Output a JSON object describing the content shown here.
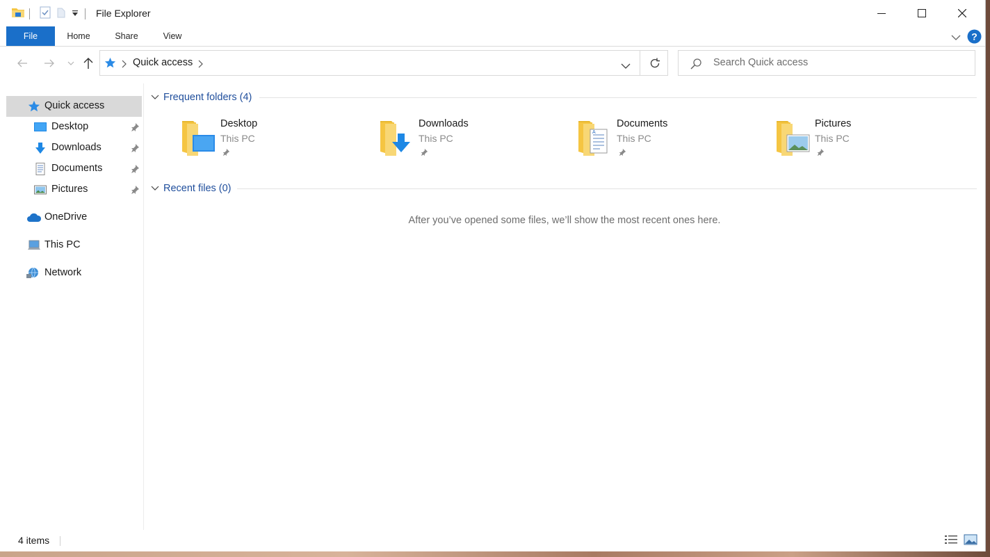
{
  "window": {
    "title": "File Explorer",
    "controls": {
      "minimize": "minimize-icon",
      "maximize": "maximize-icon",
      "close": "close-icon"
    }
  },
  "ribbon": {
    "tabs": [
      {
        "label": "File",
        "active": true
      },
      {
        "label": "Home"
      },
      {
        "label": "Share"
      },
      {
        "label": "View"
      }
    ]
  },
  "address": {
    "crumbs": [
      "Quick access"
    ]
  },
  "search": {
    "placeholder": "Search Quick access"
  },
  "navpane": {
    "items": [
      {
        "label": "Quick access",
        "icon": "star-icon",
        "selected": true,
        "pinned": false
      },
      {
        "label": "Desktop",
        "icon": "desktop-icon",
        "pinned": true
      },
      {
        "label": "Downloads",
        "icon": "download-arrow-icon",
        "pinned": true
      },
      {
        "label": "Documents",
        "icon": "document-icon",
        "pinned": true
      },
      {
        "label": "Pictures",
        "icon": "pictures-icon",
        "pinned": true
      },
      {
        "label": "OneDrive",
        "icon": "cloud-icon"
      },
      {
        "label": "This PC",
        "icon": "computer-icon"
      },
      {
        "label": "Network",
        "icon": "network-icon"
      }
    ]
  },
  "content": {
    "frequent": {
      "title": "Frequent folders (4)",
      "folders": [
        {
          "name": "Desktop",
          "location": "This PC"
        },
        {
          "name": "Downloads",
          "location": "This PC"
        },
        {
          "name": "Documents",
          "location": "This PC"
        },
        {
          "name": "Pictures",
          "location": "This PC"
        }
      ]
    },
    "recent": {
      "title": "Recent files (0)",
      "empty_message": "After you’ve opened some files, we’ll show the most recent ones here."
    }
  },
  "status": {
    "item_count": "4 items"
  },
  "colors": {
    "accent": "#1a6fc9",
    "folder": "#f8d775",
    "selection": "#d9d9d9",
    "group_title": "#1f4e9c"
  }
}
